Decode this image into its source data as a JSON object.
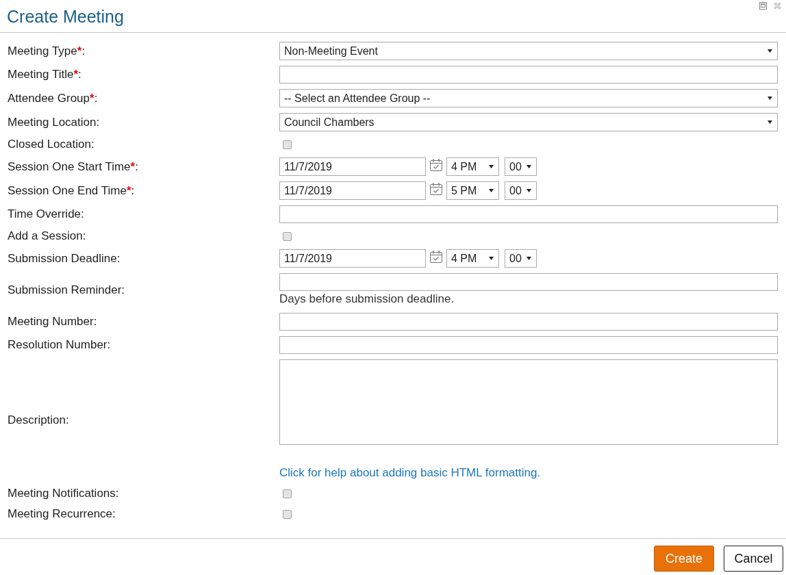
{
  "dialog": {
    "title": "Create Meeting"
  },
  "fields": [
    {
      "kind": "select",
      "label": "Meeting Type",
      "required_mark": "*",
      "label_end": ":",
      "value": "Non-Meeting Event"
    },
    {
      "kind": "text",
      "label": "Meeting Title",
      "required_mark": "*",
      "label_end": ":"
    },
    {
      "kind": "select",
      "label": "Attendee Group",
      "required_mark": "*",
      "label_end": ":",
      "value": "-- Select an Attendee Group --"
    },
    {
      "kind": "select",
      "label": "Meeting Location:",
      "value": "Council Chambers"
    },
    {
      "kind": "checkbox",
      "label": "Closed Location:",
      "checked": false
    },
    {
      "kind": "datetime",
      "label": "Session One Start Time",
      "required_mark": "*",
      "label_end": ":",
      "date": "11/7/2019",
      "hour": "4 PM",
      "minute": "00"
    },
    {
      "kind": "datetime",
      "label": "Session One End Time",
      "required_mark": "*",
      "label_end": ":",
      "date": "11/7/2019",
      "hour": "5 PM",
      "minute": "00"
    },
    {
      "kind": "text",
      "label": "Time Override:"
    },
    {
      "kind": "checkbox",
      "label": "Add a Session:",
      "checked": false
    },
    {
      "kind": "datetime",
      "label": "Submission Deadline:",
      "date": "11/7/2019",
      "hour": "4 PM",
      "minute": "00"
    },
    {
      "kind": "text",
      "label": "Submission Reminder:",
      "hint": "Days before submission deadline."
    },
    {
      "kind": "text",
      "label": "Meeting Number:"
    },
    {
      "kind": "text",
      "label": "Resolution Number:"
    },
    {
      "kind": "textarea",
      "label": "Description:",
      "help_link": "Click for help about adding basic HTML formatting."
    },
    {
      "kind": "checkbox",
      "label": "Meeting Notifications:",
      "checked": false
    },
    {
      "kind": "checkbox",
      "label": "Meeting Recurrence:",
      "checked": false
    }
  ],
  "buttons": [
    {
      "kind": "primary",
      "label": "Create"
    },
    {
      "kind": "secondary",
      "label": "Cancel"
    }
  ]
}
